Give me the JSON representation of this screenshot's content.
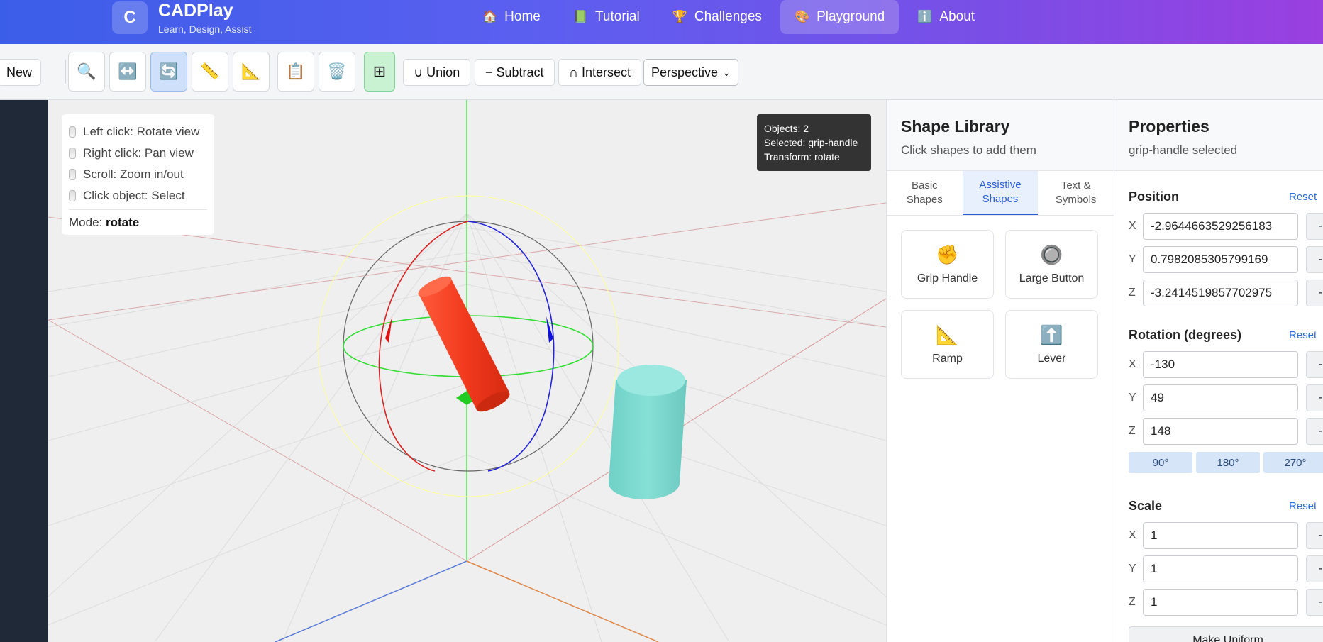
{
  "header": {
    "logo_letter": "C",
    "brand_title": "CADPlay",
    "brand_subtitle": "Learn, Design, Assist",
    "nav": [
      {
        "icon": "🏠",
        "label": "Home"
      },
      {
        "icon": "📗",
        "label": "Tutorial"
      },
      {
        "icon": "🏆",
        "label": "Challenges"
      },
      {
        "icon": "🎨",
        "label": "Playground"
      },
      {
        "icon": "ℹ️",
        "label": "About"
      }
    ]
  },
  "toolbar": {
    "new_label": "New",
    "tools": [
      {
        "icon": "🔍"
      },
      {
        "icon": "↔️"
      },
      {
        "icon": "🔄"
      },
      {
        "icon": "📏"
      },
      {
        "icon": "📐"
      },
      {
        "icon": "📋"
      },
      {
        "icon": "🗑️"
      },
      {
        "icon": "⊞"
      }
    ],
    "union_label": "∪ Union",
    "subtract_label": "− Subtract",
    "intersect_label": "∩ Intersect",
    "view_mode": "Perspective"
  },
  "viewport": {
    "help": [
      "Left click: Rotate view",
      "Right click: Pan view",
      "Scroll: Zoom in/out",
      "Click object: Select"
    ],
    "mode_label": "Mode:",
    "mode_value": "rotate",
    "status": {
      "objects": "Objects: 2",
      "selected": "Selected: grip-handle",
      "transform": "Transform: rotate"
    }
  },
  "library": {
    "title": "Shape Library",
    "subtitle": "Click shapes to add them",
    "tabs": [
      {
        "line1": "Basic",
        "line2": "Shapes"
      },
      {
        "line1": "Assistive",
        "line2": "Shapes"
      },
      {
        "line1": "Text &",
        "line2": "Symbols"
      }
    ],
    "shapes": [
      {
        "icon": "✊",
        "label": "Grip Handle"
      },
      {
        "icon": "🔘",
        "label": "Large Button"
      },
      {
        "icon": "📐",
        "label": "Ramp"
      },
      {
        "icon": "⬆️",
        "label": "Lever"
      }
    ]
  },
  "properties": {
    "title": "Properties",
    "subtitle": "grip-handle selected",
    "reset_label": "Reset",
    "minus_label": "-",
    "position": {
      "title": "Position",
      "x": "-2.9644663529256183",
      "y": "0.7982085305799169",
      "z": "-3.2414519857702975"
    },
    "rotation": {
      "title": "Rotation (degrees)",
      "x": "-130",
      "y": "49",
      "z": "148",
      "quick": [
        "90°",
        "180°",
        "270°"
      ]
    },
    "scale": {
      "title": "Scale",
      "x": "1",
      "y": "1",
      "z": "1"
    },
    "make_uniform_label": "Make Uniform",
    "axis_labels": {
      "x": "X",
      "y": "Y",
      "z": "Z"
    }
  },
  "colors": {
    "accent": "#2b5fd9",
    "selected_object": "#f24a2a",
    "other_object": "#7fd8cf"
  }
}
